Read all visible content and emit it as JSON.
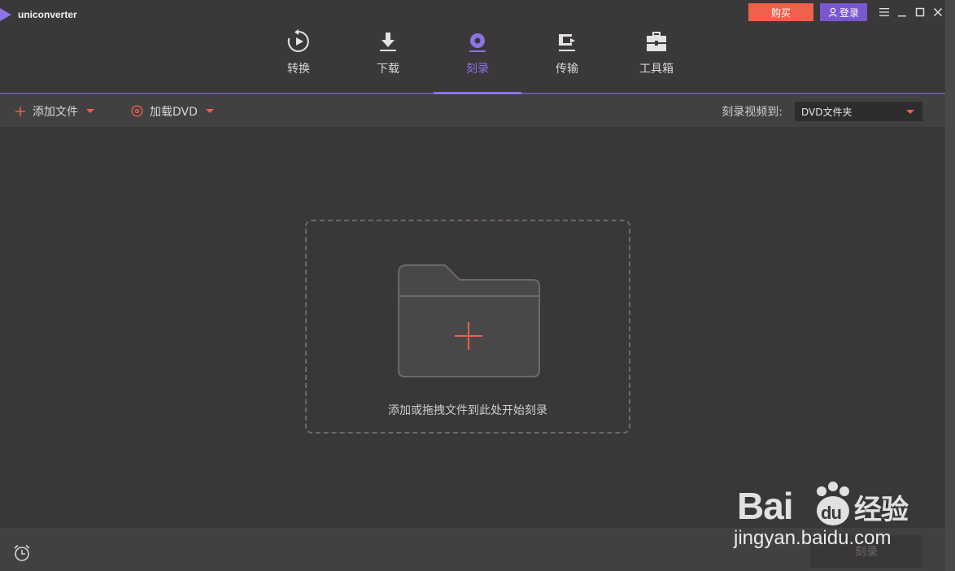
{
  "app": {
    "name": "uniconverter"
  },
  "window": {
    "buy_label": "购买",
    "login_label": "登录"
  },
  "nav": {
    "items": [
      {
        "label": "转换",
        "icon": "convert-icon",
        "active": false
      },
      {
        "label": "下载",
        "icon": "download-icon",
        "active": false
      },
      {
        "label": "刻录",
        "icon": "burn-icon",
        "active": true
      },
      {
        "label": "传输",
        "icon": "transfer-icon",
        "active": false
      },
      {
        "label": "工具箱",
        "icon": "toolbox-icon",
        "active": false
      }
    ]
  },
  "toolbar": {
    "add_files_label": "添加文件",
    "load_dvd_label": "加载DVD",
    "burn_to_label": "刻录视频到:",
    "burn_target_value": "DVD文件夹"
  },
  "dropzone": {
    "hint": "添加或拖拽文件到此处开始刻录"
  },
  "bottom": {
    "burn_label": "刻录"
  },
  "watermark": {
    "brand": "Bai du 经验",
    "url": "jingyan.baidu.com"
  },
  "colors": {
    "accent": "#8e72e6",
    "buy": "#f0604a",
    "login": "#7a57d1",
    "background": "#3a3738"
  }
}
